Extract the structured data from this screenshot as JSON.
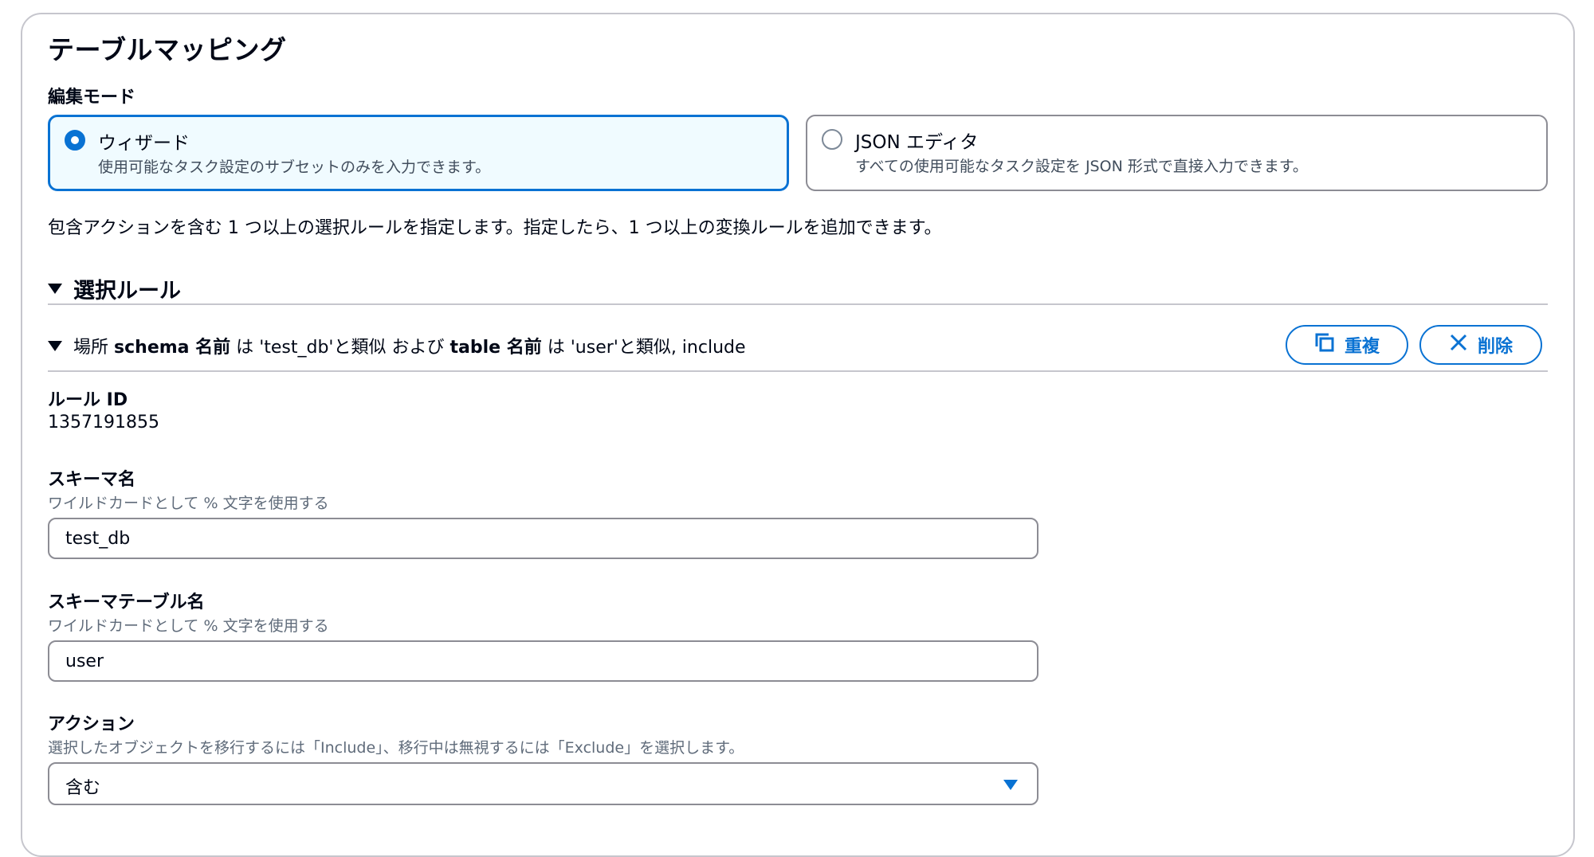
{
  "page": {
    "title": "テーブルマッピング",
    "edit_mode_label": "編集モード",
    "modes": [
      {
        "title": "ウィザード",
        "description": "使用可能なタスク設定のサブセットのみを入力できます。",
        "selected": true
      },
      {
        "title": "JSON エディタ",
        "description": "すべての使用可能なタスク設定を JSON 形式で直接入力できます。",
        "selected": false
      }
    ],
    "intro": "包含アクションを含む 1 つ以上の選択ルールを指定します。指定したら、1 つ以上の変換ルールを追加できます。"
  },
  "selection_rules": {
    "title": "選択ルール",
    "rule": {
      "summary": {
        "prefix": "場所",
        "schema_kw": "schema 名前",
        "is1": "は",
        "schema_val": "'test_db'と類似",
        "and": "および",
        "table_kw": "table 名前",
        "is2": "は",
        "table_val": "'user'と類似, include"
      },
      "duplicate_label": "重複",
      "delete_label": "削除",
      "rule_id_label": "ルール ID",
      "rule_id_value": "1357191855",
      "schema": {
        "label": "スキーマ名",
        "hint": "ワイルドカードとして % 文字を使用する",
        "value": "test_db"
      },
      "table": {
        "label": "スキーマテーブル名",
        "hint": "ワイルドカードとして % 文字を使用する",
        "value": "user"
      },
      "action": {
        "label": "アクション",
        "hint": "選択したオブジェクトを移行するには「Include」、移行中は無視するには「Exclude」を選択します。",
        "value": "含む"
      }
    }
  },
  "colors": {
    "accent": "#0972d3",
    "selected_tile_bg": "#f0fbff",
    "border": "#8c8c94",
    "text": "#000716",
    "muted": "#5f6b7a"
  },
  "icons": [
    "radio-selected-icon",
    "radio-unselected-icon",
    "caret-down-icon",
    "copy-icon",
    "close-icon",
    "dropdown-caret-icon"
  ]
}
